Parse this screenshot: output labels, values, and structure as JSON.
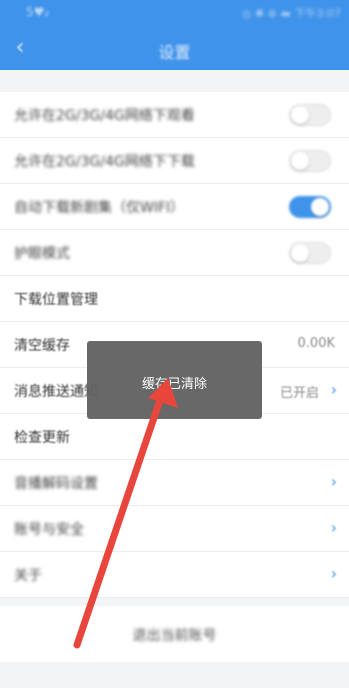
{
  "status_bar": {
    "left_text": "5♥₂",
    "right_text": "◎ ✱ ⊕ ▬ 下午3:07"
  },
  "header": {
    "title": "设置",
    "back_icon": "chevron-left-icon"
  },
  "settings": {
    "rows": [
      {
        "label": "允许在2G/3G/4G网络下观看",
        "toggle": false
      },
      {
        "label": "允许在2G/3G/4G网络下下载",
        "toggle": false
      },
      {
        "label": "自动下载新剧集（仅WIFI）",
        "toggle": true
      },
      {
        "label": "护眼模式",
        "toggle": false
      },
      {
        "label": "下载位置管理"
      },
      {
        "label": "清空缓存",
        "value": "0.00K"
      },
      {
        "label": "消息推送通知",
        "value": "已开启"
      },
      {
        "label": "检查更新"
      },
      {
        "label": "音播解码设置"
      },
      {
        "label": "账号与安全"
      },
      {
        "label": "关于"
      }
    ]
  },
  "logout": {
    "label": "退出当前账号"
  },
  "toast": {
    "text": "缓存已清除"
  },
  "colors": {
    "accent": "#3f93ea",
    "arrow": "#e8463c",
    "toast_bg": "#626262"
  }
}
